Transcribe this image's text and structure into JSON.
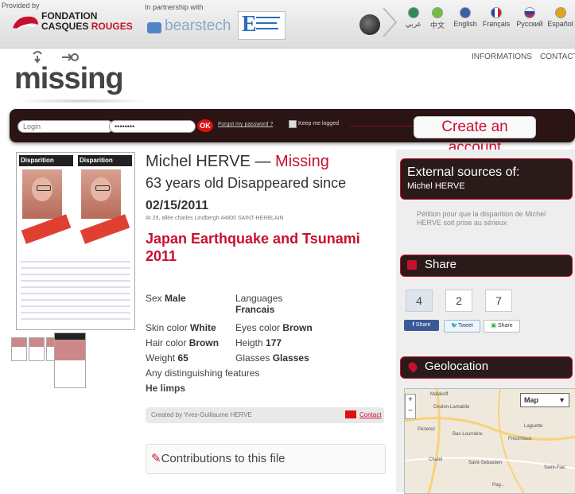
{
  "topbar": {
    "provided_by": "Provided by",
    "foundation_line1": "FONDATION",
    "foundation_line2a": "CASQUES ",
    "foundation_line2b": "ROUGES",
    "partnership": "In partnership with",
    "bearstech": "bearstech",
    "languages": [
      {
        "label": "عربي",
        "color": "#2e8b57"
      },
      {
        "label": "中文",
        "color": "#6fbf3f"
      },
      {
        "label": "English",
        "color": "#3b5da8"
      },
      {
        "label": "Français",
        "color": "#2244aa"
      },
      {
        "label": "Русский",
        "color": "#cc2233"
      },
      {
        "label": "Español",
        "color": "#e3a317"
      }
    ]
  },
  "header": {
    "logo": "missing",
    "nav_informations": "INFORMATIONS",
    "nav_contact": "CONTACT"
  },
  "login": {
    "login_placeholder": "Login",
    "password_value": "••••••••",
    "ok_label": "OK",
    "forgot_password": "Forgot my password ?",
    "keep_logged": "Keep me logged",
    "create_account": "Create an account"
  },
  "person": {
    "name": "Michel HERVE",
    "dash": " — ",
    "status": "Missing",
    "age_line": "63 years old Disappeared since",
    "date": "02/15/2011",
    "address": "At 29, allée charles Lindbergh 44800 SAINT-HERBLAIN",
    "event": "Japan Earthquake and Tsunami 2011"
  },
  "attributes": {
    "sex_label": "Sex",
    "sex_value": "Male",
    "languages_label": "Languages",
    "languages_value": "Francais",
    "skin_label": "Skin color",
    "skin_value": "White",
    "eyes_label": "Eyes color",
    "eyes_value": "Brown",
    "hair_label": "Hair color",
    "hair_value": "Brown",
    "height_label": "Heigth",
    "height_value": "177",
    "weight_label": "Weight",
    "weight_value": "65",
    "glasses_label": "Glasses",
    "glasses_value": "Glasses",
    "features_label": "Any distinguishing features",
    "features_value": "He limps"
  },
  "created_by": "Created by Yves-Guillaume HERVE",
  "contact_label": "Contact",
  "contributions_title": "Contributions to this file",
  "poster_heading": "Disparition",
  "sidebar": {
    "external_title": "External sources of:",
    "external_name": "Michel HERVE",
    "external_link": "Pétition pour que la disparition de Michel HERVE soit prise au sérieux",
    "share_title": "Share",
    "share_counts": [
      "4",
      "2",
      "7"
    ],
    "fb_share": "Share",
    "tweet": "Tweet",
    "share_other": "Share",
    "geo_title": "Geolocation",
    "map_type": "Map",
    "map_places": [
      "Malakoff",
      "Doulon-Lamabile",
      "Penerez",
      "Bas-Lourraine",
      "Laguette",
      "Frecinhaux",
      "Chatel",
      "Saint-Sebastien",
      "Saint-Fiac",
      "Pag..."
    ]
  }
}
